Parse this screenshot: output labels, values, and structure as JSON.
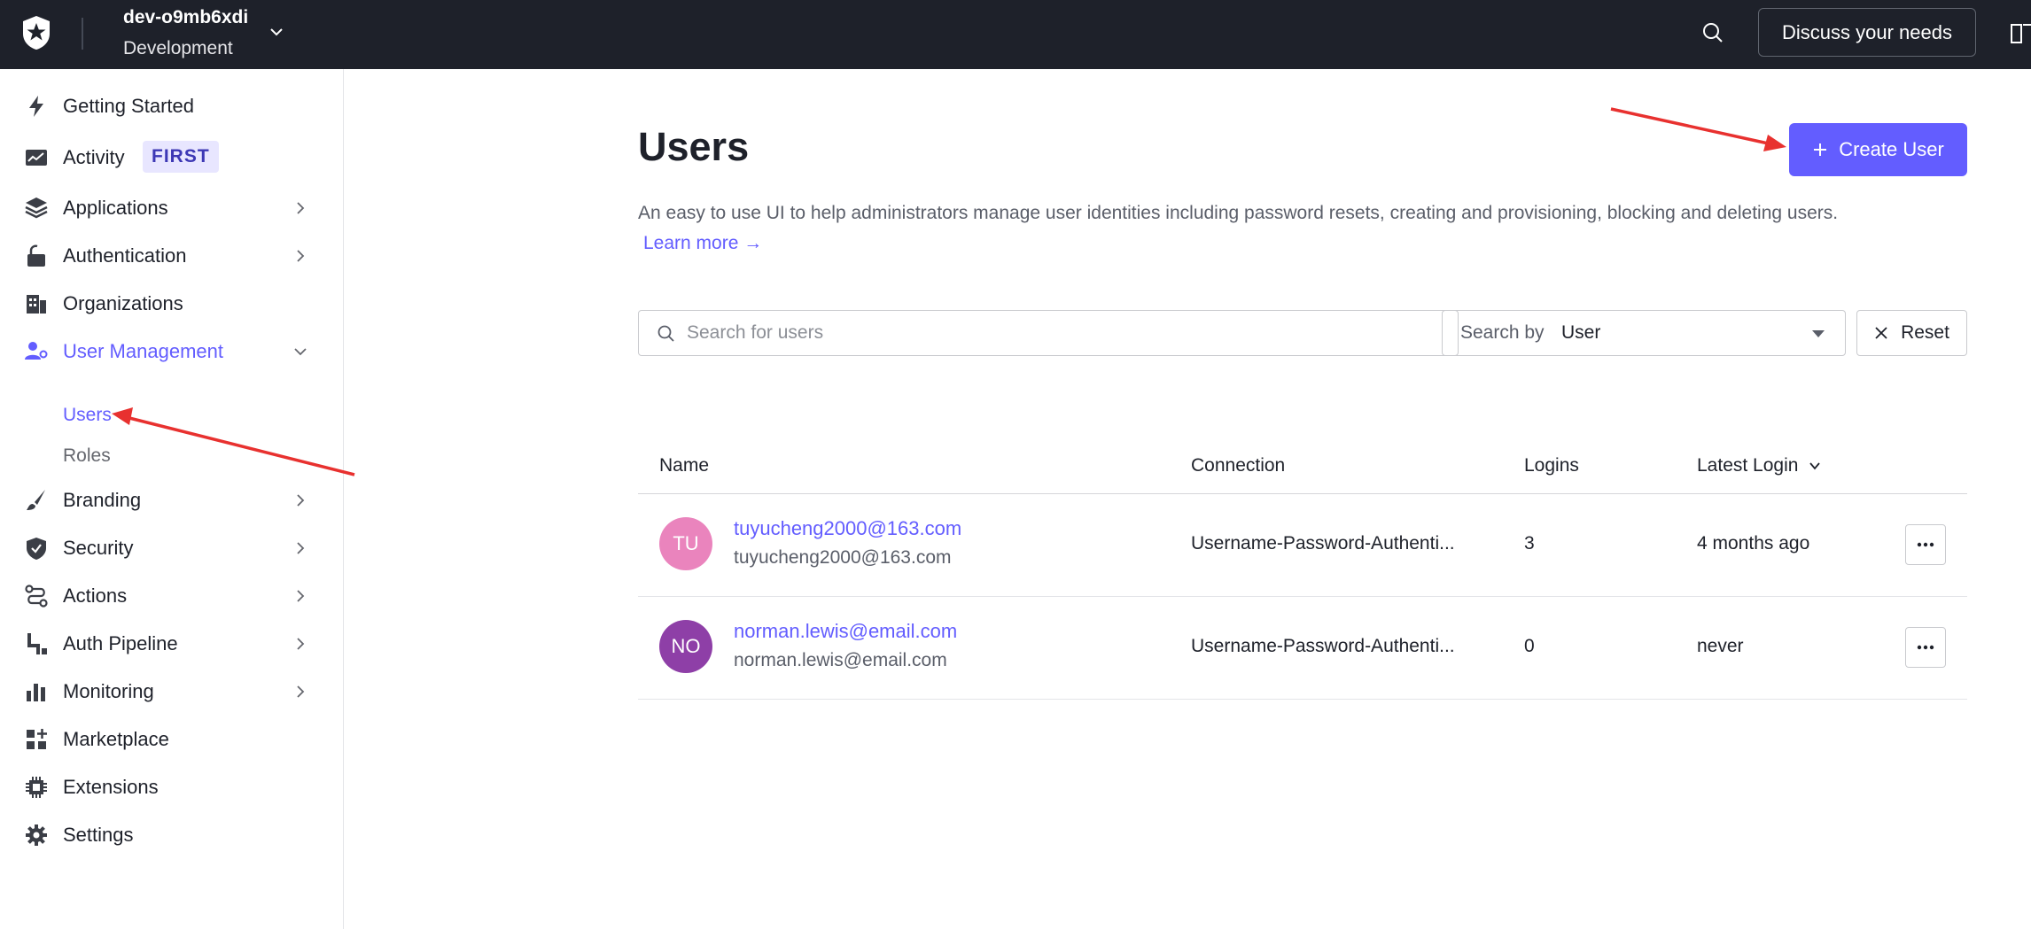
{
  "topbar": {
    "tenant_name": "dev-o9mb6xdi",
    "tenant_env": "Development",
    "discuss_label": "Discuss your needs"
  },
  "sidebar": {
    "items": [
      {
        "label": "Getting Started",
        "icon": "bolt-icon"
      },
      {
        "label": "Activity",
        "icon": "activity-chart-icon",
        "badge": "FIRST"
      },
      {
        "label": "Applications",
        "icon": "layers-icon"
      },
      {
        "label": "Authentication",
        "icon": "unlock-icon"
      },
      {
        "label": "Organizations",
        "icon": "building-icon"
      },
      {
        "label": "User Management",
        "icon": "users-gear-icon"
      },
      {
        "label": "Branding",
        "icon": "brush-icon"
      },
      {
        "label": "Security",
        "icon": "shield-check-icon"
      },
      {
        "label": "Actions",
        "icon": "flow-icon"
      },
      {
        "label": "Auth Pipeline",
        "icon": "pipeline-icon"
      },
      {
        "label": "Monitoring",
        "icon": "bar-chart-icon"
      },
      {
        "label": "Marketplace",
        "icon": "grid-plus-icon"
      },
      {
        "label": "Extensions",
        "icon": "chip-icon"
      },
      {
        "label": "Settings",
        "icon": "gear-icon"
      }
    ],
    "subitems": [
      "Users",
      "Roles"
    ]
  },
  "main": {
    "title": "Users",
    "create_label": "Create User",
    "description": "An easy to use UI to help administrators manage user identities including password resets, creating and provisioning, blocking and deleting users.",
    "learn_more": "Learn more →",
    "search_placeholder": "Search for users",
    "search_by_label": "Search by",
    "search_by_value": "User",
    "reset_label": "Reset"
  },
  "table": {
    "columns": [
      "Name",
      "Connection",
      "Logins",
      "Latest Login"
    ],
    "rows": [
      {
        "initials": "TU",
        "avatar_color": "#ea84bd",
        "email": "tuyucheng2000@163.com",
        "sub": "tuyucheng2000@163.com",
        "connection": "Username-Password-Authenti...",
        "logins": "3",
        "latest": "4 months ago"
      },
      {
        "initials": "NO",
        "avatar_color": "#8e3fa7",
        "email": "norman.lewis@email.com",
        "sub": "norman.lewis@email.com",
        "connection": "Username-Password-Authenti...",
        "logins": "0",
        "latest": "never"
      }
    ]
  },
  "colors": {
    "accent": "#635dff",
    "topbar": "#1e212a",
    "annotation": "#e8312f"
  }
}
